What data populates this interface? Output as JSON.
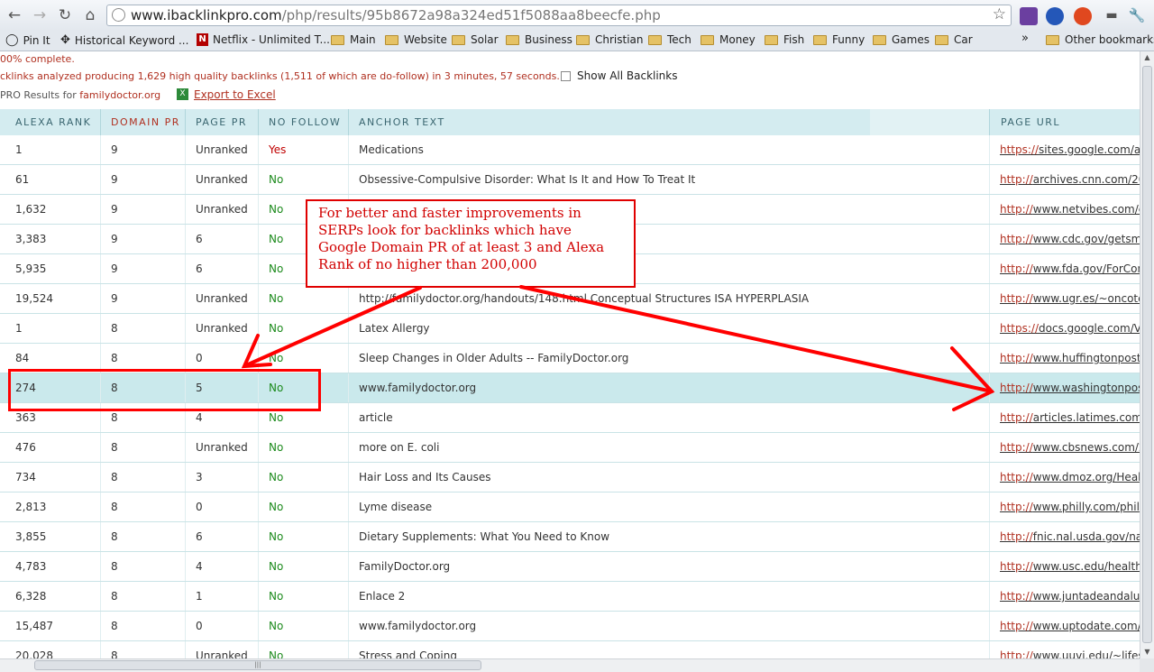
{
  "browser": {
    "url_host": "www.ibacklinkpro.com",
    "url_rest": "/php/results/95b8672a98a324ed51f5088aa8beecfe.php",
    "bookmarks": [
      {
        "label": "Pin It",
        "icon": "pin-icon"
      },
      {
        "label": "Historical Keyword ...",
        "icon": "move-icon"
      },
      {
        "label": "Netflix - Unlimited T...",
        "icon": "netflix-icon"
      },
      {
        "label": "Main",
        "icon": "folder-icon"
      },
      {
        "label": "Website",
        "icon": "folder-icon"
      },
      {
        "label": "Solar",
        "icon": "folder-icon"
      },
      {
        "label": "Business",
        "icon": "folder-icon"
      },
      {
        "label": "Christian",
        "icon": "folder-icon"
      },
      {
        "label": "Tech",
        "icon": "folder-icon"
      },
      {
        "label": "Money",
        "icon": "folder-icon"
      },
      {
        "label": "Fish",
        "icon": "folder-icon"
      },
      {
        "label": "Funny",
        "icon": "folder-icon"
      },
      {
        "label": "Games",
        "icon": "folder-icon"
      },
      {
        "label": "Car",
        "icon": "folder-icon"
      }
    ],
    "overflow": "»",
    "other_bookmarks": "Other bookmarks"
  },
  "page": {
    "status": "00% complete.",
    "summary": "cklinks analyzed producing 1,629 high quality backlinks (1,511 of which are do-follow) in 3 minutes, 57 seconds.",
    "show_all_label": "Show All Backlinks",
    "results_prefix": "PRO Results for",
    "results_domain": "familydoctor.org",
    "export_label": "Export to Excel"
  },
  "table": {
    "headers": [
      "ALEXA RANK",
      "DOMAIN PR",
      "PAGE PR",
      "NO FOLLOW",
      "ANCHOR TEXT",
      "PAGE URL"
    ],
    "rows": [
      {
        "alexa": "1",
        "domain_pr": "9",
        "page_pr": "Unranked",
        "nofollow": "Yes",
        "anchor": "Medications",
        "url_h": "https://",
        "url_rest": "sites.google.com/a/"
      },
      {
        "alexa": "61",
        "domain_pr": "9",
        "page_pr": "Unranked",
        "nofollow": "No",
        "anchor": "Obsessive-Compulsive Disorder: What Is It and How To Treat It",
        "url_h": "http://",
        "url_rest": "archives.cnn.com/20"
      },
      {
        "alexa": "1,632",
        "domain_pr": "9",
        "page_pr": "Unranked",
        "nofollow": "No",
        "anchor": "",
        "url_h": "http://",
        "url_rest": "www.netvibes.com/c"
      },
      {
        "alexa": "3,383",
        "domain_pr": "9",
        "page_pr": "6",
        "nofollow": "No",
        "anchor": "",
        "url_h": "http://",
        "url_rest": "www.cdc.gov/getsma"
      },
      {
        "alexa": "5,935",
        "domain_pr": "9",
        "page_pr": "6",
        "nofollow": "No",
        "anchor": "",
        "url_h": "http://",
        "url_rest": "www.fda.gov/ForCon"
      },
      {
        "alexa": "19,524",
        "domain_pr": "9",
        "page_pr": "Unranked",
        "nofollow": "No",
        "anchor": "http://familydoctor.org/handouts/148.html Conceptual Structures ISA HYPERPLASIA",
        "url_h": "http://",
        "url_rest": "www.ugr.es/~oncote"
      },
      {
        "alexa": "1",
        "domain_pr": "8",
        "page_pr": "Unranked",
        "nofollow": "No",
        "anchor": "Latex Allergy",
        "url_h": "https://",
        "url_rest": "docs.google.com/Vi"
      },
      {
        "alexa": "84",
        "domain_pr": "8",
        "page_pr": "0",
        "nofollow": "No",
        "anchor": "Sleep Changes in Older Adults -- FamilyDoctor.org",
        "url_h": "http://",
        "url_rest": "www.huffingtonpost."
      },
      {
        "alexa": "274",
        "domain_pr": "8",
        "page_pr": "5",
        "nofollow": "No",
        "anchor": "www.familydoctor.org",
        "url_h": "http://",
        "url_rest": "www.washingtonpost"
      },
      {
        "alexa": "363",
        "domain_pr": "8",
        "page_pr": "4",
        "nofollow": "No",
        "anchor": "article",
        "url_h": "http://",
        "url_rest": "articles.latimes.com/"
      },
      {
        "alexa": "476",
        "domain_pr": "8",
        "page_pr": "Unranked",
        "nofollow": "No",
        "anchor": "more on E. coli",
        "url_h": "http://",
        "url_rest": "www.cbsnews.com/2"
      },
      {
        "alexa": "734",
        "domain_pr": "8",
        "page_pr": "3",
        "nofollow": "No",
        "anchor": "Hair Loss and Its Causes",
        "url_h": "http://",
        "url_rest": "www.dmoz.org/Healt"
      },
      {
        "alexa": "2,813",
        "domain_pr": "8",
        "page_pr": "0",
        "nofollow": "No",
        "anchor": "Lyme disease",
        "url_h": "http://",
        "url_rest": "www.philly.com/phil"
      },
      {
        "alexa": "3,855",
        "domain_pr": "8",
        "page_pr": "6",
        "nofollow": "No",
        "anchor": "Dietary Supplements: What You Need to Know",
        "url_h": "http://",
        "url_rest": "fnic.nal.usda.gov/nal"
      },
      {
        "alexa": "4,783",
        "domain_pr": "8",
        "page_pr": "4",
        "nofollow": "No",
        "anchor": "FamilyDoctor.org",
        "url_h": "http://",
        "url_rest": "www.usc.edu/health"
      },
      {
        "alexa": "6,328",
        "domain_pr": "8",
        "page_pr": "1",
        "nofollow": "No",
        "anchor": "Enlace 2",
        "url_h": "http://",
        "url_rest": "www.juntadeandaluc"
      },
      {
        "alexa": "15,487",
        "domain_pr": "8",
        "page_pr": "0",
        "nofollow": "No",
        "anchor": "www.familydoctor.org",
        "url_h": "http://",
        "url_rest": "www.uptodate.com/"
      },
      {
        "alexa": "20,028",
        "domain_pr": "8",
        "page_pr": "Unranked",
        "nofollow": "No",
        "anchor": "Stress and Coping",
        "url_h": "http://",
        "url_rest": "www.uuvi.edu/~lifes"
      }
    ]
  },
  "annotation": {
    "callout_text": "For better and faster improvements in SERPs look for backlinks which have Google Domain PR of at least 3 and Alexa Rank of no higher than 200,000"
  },
  "colors": {
    "annotation_red": "#e00000",
    "accent_red": "#b03020",
    "nofollow_no": "#1c8a1c",
    "header_teal": "#d4ecf0"
  }
}
